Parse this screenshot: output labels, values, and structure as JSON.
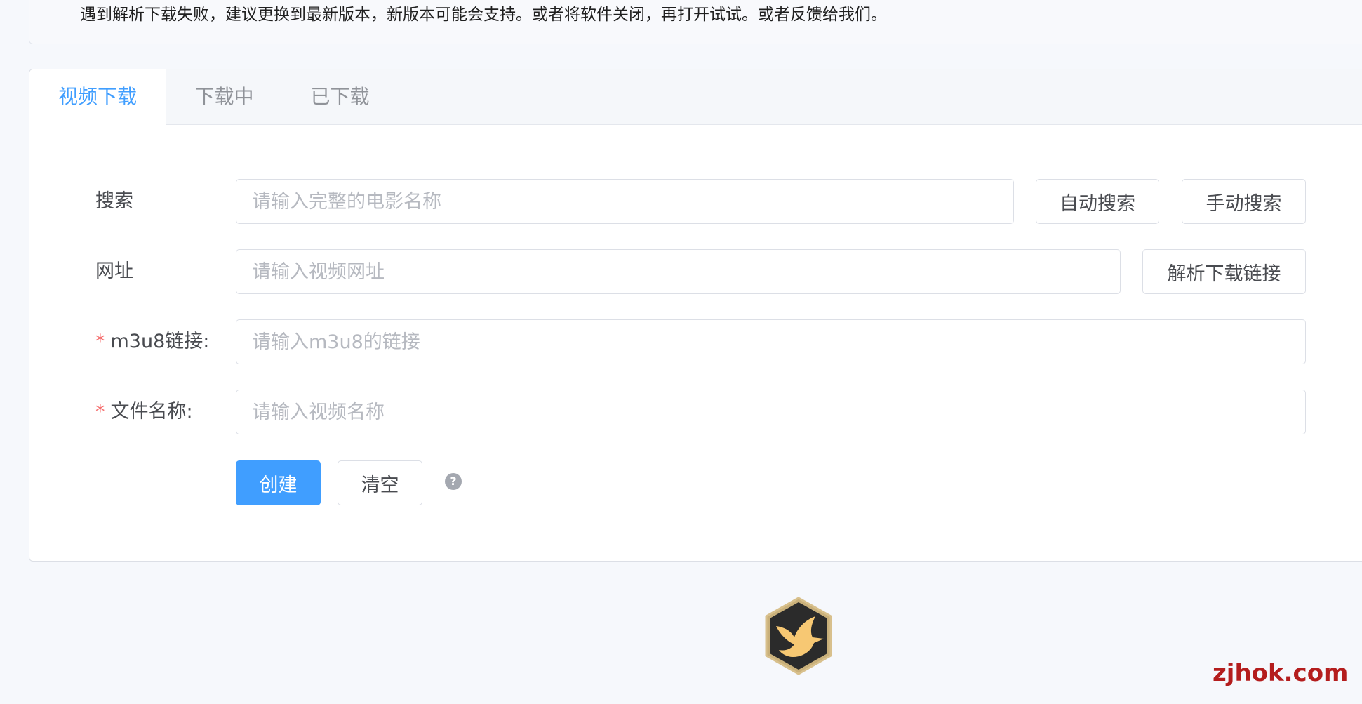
{
  "notice": {
    "text": "遇到解析下载失败，建议更换到最新版本，新版本可能会支持。或者将软件关闭，再打开试试。或者反馈给我们。"
  },
  "tabs": [
    {
      "label": "视频下载",
      "active": true
    },
    {
      "label": "下载中",
      "active": false
    },
    {
      "label": "已下载",
      "active": false
    }
  ],
  "form": {
    "search": {
      "label": "搜索",
      "value": "",
      "placeholder": "请输入完整的电影名称",
      "auto_button": "自动搜索",
      "manual_button": "手动搜索"
    },
    "url": {
      "label": "网址",
      "value": "",
      "placeholder": "请输入视频网址",
      "parse_button": "解析下载链接"
    },
    "m3u8": {
      "required_mark": "*",
      "label": "m3u8链接:",
      "value": "",
      "placeholder": "请输入m3u8的链接"
    },
    "filename": {
      "required_mark": "*",
      "label": "文件名称:",
      "value": "",
      "placeholder": "请输入视频名称"
    },
    "actions": {
      "create_button": "创建",
      "clear_button": "清空",
      "help_icon": "question-circle-icon",
      "help_glyph": "?"
    }
  },
  "logo": {
    "icon": "hummingbird-icon"
  },
  "watermark": {
    "text": "zjhok.com"
  },
  "colors": {
    "accent": "#409eff",
    "required": "#f56c6c",
    "watermark": "#b41d1d",
    "logo_background": "#2b2b2b",
    "logo_bird": "#f7c873"
  }
}
